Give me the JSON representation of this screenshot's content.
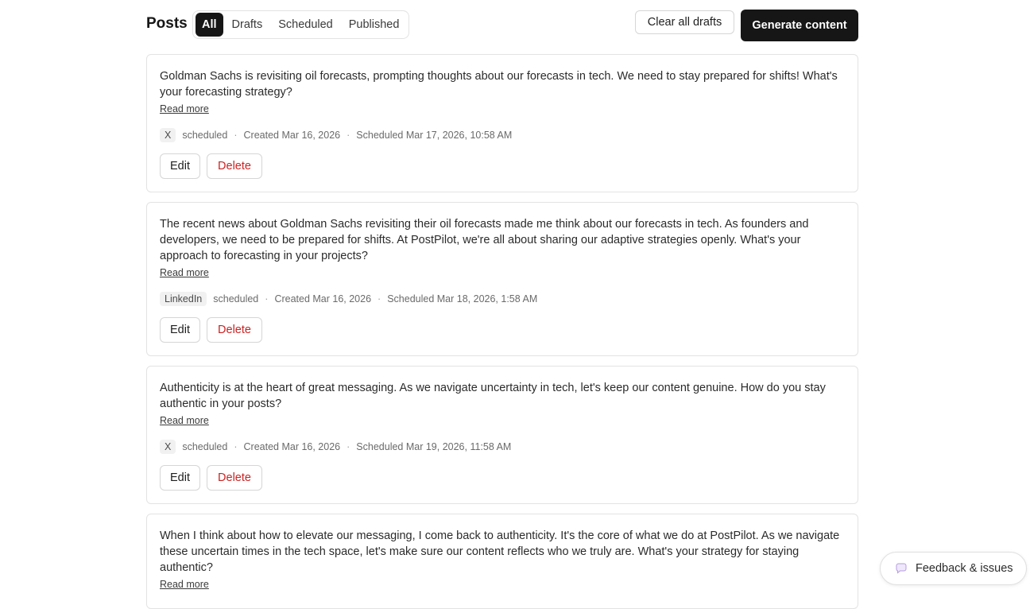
{
  "header": {
    "title": "Posts",
    "tabs": [
      "All",
      "Drafts",
      "Scheduled",
      "Published"
    ],
    "active_tab": "All",
    "clear_drafts_label": "Clear all drafts",
    "generate_label": "Generate content"
  },
  "posts": [
    {
      "text": "Goldman Sachs is revisiting oil forecasts, prompting thoughts about our forecasts in tech. We need to stay prepared for shifts! What's your forecasting strategy?",
      "read_more": "Read more",
      "platform": "X",
      "status": "scheduled",
      "created": "Created Mar 16, 2026",
      "scheduled": "Scheduled Mar 17, 2026, 10:58 AM",
      "edit_label": "Edit",
      "delete_label": "Delete"
    },
    {
      "text": "The recent news about Goldman Sachs revisiting their oil forecasts made me think about our forecasts in tech. As founders and developers, we need to be prepared for shifts. At PostPilot, we're all about sharing our adaptive strategies openly. What's your approach to forecasting in your projects?",
      "read_more": "Read more",
      "platform": "LinkedIn",
      "status": "scheduled",
      "created": "Created Mar 16, 2026",
      "scheduled": "Scheduled Mar 18, 2026, 1:58 AM",
      "edit_label": "Edit",
      "delete_label": "Delete"
    },
    {
      "text": "Authenticity is at the heart of great messaging. As we navigate uncertainty in tech, let's keep our content genuine. How do you stay authentic in your posts?",
      "read_more": "Read more",
      "platform": "X",
      "status": "scheduled",
      "created": "Created Mar 16, 2026",
      "scheduled": "Scheduled Mar 19, 2026, 11:58 AM",
      "edit_label": "Edit",
      "delete_label": "Delete"
    },
    {
      "text": "When I think about how to elevate our messaging, I come back to authenticity. It's the core of what we do at PostPilot. As we navigate these uncertain times in the tech space, let's make sure our content reflects who we truly are. What's your strategy for staying authentic?",
      "read_more": "Read more"
    }
  ],
  "feedback": {
    "label": "Feedback & issues",
    "icon": "chat-bubble-icon"
  },
  "colors": {
    "primary": "#161616",
    "danger": "#cc2222",
    "border": "#e3e3e3"
  }
}
